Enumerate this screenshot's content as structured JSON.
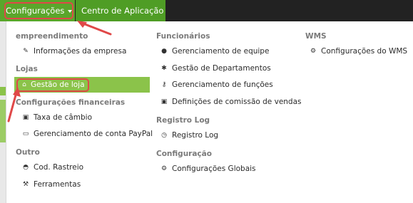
{
  "nav": {
    "configuracoes": "Configurações",
    "centro_aplicacao": "Centro de Aplicação"
  },
  "col1": {
    "empreendimento": {
      "heading": "empreendimento",
      "items": [
        "Informações da empresa"
      ]
    },
    "lojas": {
      "heading": "Lojas",
      "items": [
        "Gestão de loja"
      ]
    },
    "config_financeiras": {
      "heading": "Configurações financeiras",
      "items": [
        "Taxa de câmbio",
        "Gerenciamento de conta PayPal"
      ]
    },
    "outro": {
      "heading": "Outro",
      "items": [
        "Cod. Rastreio",
        "Ferramentas"
      ]
    }
  },
  "col2": {
    "funcionarios": {
      "heading": "Funcionários",
      "items": [
        "Gerenciamento de equipe",
        "Gestão de Departamentos",
        "Gerenciamento de funções",
        "Definições de comissão de vendas"
      ]
    },
    "registro_log": {
      "heading": "Registro Log",
      "items": [
        "Registro Log"
      ]
    },
    "configuracao": {
      "heading": "Configuração",
      "items": [
        "Configurações Globais"
      ]
    }
  },
  "col3": {
    "wms": {
      "heading": "WMS",
      "items": [
        "Configurações do WMS"
      ]
    }
  },
  "icons": {
    "informacoes": "edit-icon",
    "gestao_loja": "home-icon",
    "taxa_cambio": "money-icon",
    "paypal": "credit-card-icon",
    "rastreio": "inbox-icon",
    "ferramentas": "wrench-icon",
    "equipe": "user-icon",
    "departamentos": "asterisk-icon",
    "funcoes": "key-icon",
    "comissao": "money-icon",
    "registro_log": "clock-icon",
    "configuracoes_globais": "gear-icon",
    "wms": "gear-icon"
  },
  "colors": {
    "nav_green": "#5aa62b",
    "active_green": "#8bc34a",
    "highlight_red": "#e04848"
  }
}
